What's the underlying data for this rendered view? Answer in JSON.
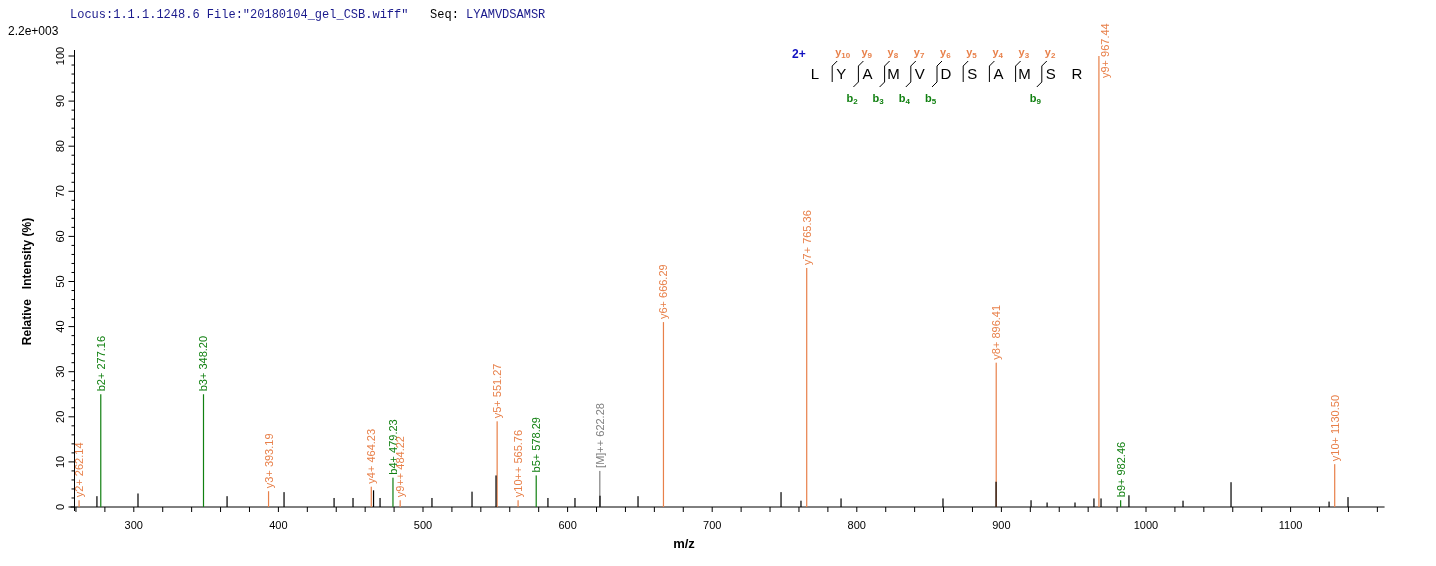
{
  "header": {
    "locus": "Locus:1.1.1.1248.6",
    "file": "File:\"20180104_gel_CSB.wiff\"",
    "seq_label": "Seq:",
    "seq": "LYAMVDSAMSR"
  },
  "scale_label": "2.2e+003",
  "fragment_map": {
    "charge": "2+",
    "residues": [
      "L",
      "Y",
      "A",
      "M",
      "V",
      "D",
      "S",
      "A",
      "M",
      "S",
      "R"
    ],
    "breaks": [
      {
        "y_ion": "y$_{10}$"
      },
      {
        "y_ion": "y$_{9}$",
        "b_ion": "b$_{2}$"
      },
      {
        "y_ion": "y$_{8}$",
        "b_ion": "b$_{3}$"
      },
      {
        "y_ion": "y$_{7}$",
        "b_ion": "b$_{4}$"
      },
      {
        "y_ion": "y$_{6}$",
        "b_ion": "b$_{5}$"
      },
      {
        "y_ion": "y$_{5}$"
      },
      {
        "y_ion": "y$_{4}$"
      },
      {
        "y_ion": "y$_{3}$"
      },
      {
        "y_ion": "y$_{2}$",
        "b_ion": "b$_{9}$"
      }
    ]
  },
  "chart_data": {
    "type": "bar",
    "xlabel": "m/z",
    "ylabel": "Relative   Intensity (%)",
    "xlim": [
      259,
      1165
    ],
    "ylim": [
      0,
      100
    ],
    "xticks": [
      300,
      400,
      500,
      600,
      700,
      800,
      900,
      1000,
      1100
    ],
    "yticks": [
      0,
      10,
      20,
      30,
      40,
      50,
      60,
      70,
      80,
      90,
      100
    ],
    "x": [
      262.14,
      274.5,
      277.16,
      302.9,
      348.2,
      364.5,
      393.19,
      403.9,
      438.5,
      451.6,
      464.23,
      465.8,
      470.3,
      479.23,
      484.22,
      506.2,
      533.9,
      550.5,
      551.27,
      565.76,
      578.29,
      586.4,
      605.1,
      622.28,
      622.4,
      648.7,
      666.29,
      747.6,
      761.4,
      765.36,
      789.1,
      859.6,
      896.3,
      896.41,
      920.5,
      931.6,
      950.9,
      964.0,
      967.44,
      968.9,
      982.46,
      988.2,
      1025.6,
      1058.8,
      1126.6,
      1130.5,
      1139.7
    ],
    "series": [
      {
        "color": "#e8804a",
        "values": [
          1.5,
          null,
          null,
          null,
          null,
          null,
          3.5,
          null,
          null,
          null,
          4.5,
          null,
          null,
          null,
          1.5,
          null,
          null,
          null,
          19,
          1.5,
          null,
          null,
          null,
          null,
          null,
          null,
          41,
          null,
          null,
          53,
          null,
          null,
          null,
          32,
          null,
          null,
          null,
          null,
          100,
          null,
          null,
          null,
          null,
          null,
          null,
          9.5,
          null
        ]
      },
      {
        "color": "#118011",
        "values": [
          null,
          null,
          25,
          null,
          25,
          null,
          null,
          null,
          null,
          null,
          null,
          null,
          null,
          6.5,
          null,
          null,
          null,
          null,
          null,
          null,
          7,
          null,
          null,
          null,
          null,
          null,
          null,
          null,
          null,
          null,
          null,
          null,
          null,
          null,
          null,
          null,
          null,
          null,
          null,
          null,
          1.5,
          null,
          null,
          null,
          null,
          null,
          null
        ]
      },
      {
        "color": "#808080",
        "values": [
          null,
          null,
          null,
          null,
          null,
          null,
          null,
          null,
          null,
          null,
          null,
          null,
          null,
          null,
          null,
          null,
          null,
          null,
          null,
          null,
          null,
          null,
          null,
          8,
          null,
          null,
          null,
          null,
          null,
          null,
          null,
          null,
          null,
          null,
          null,
          null,
          null,
          null,
          null,
          null,
          null,
          null,
          null,
          null,
          null,
          null,
          null
        ]
      },
      {
        "color": "#000000",
        "values": [
          null,
          2.4,
          null,
          3,
          null,
          2.4,
          null,
          3.3,
          2,
          2,
          null,
          3.7,
          2,
          null,
          null,
          2,
          3.4,
          7,
          null,
          null,
          null,
          2,
          2,
          null,
          2.5,
          2.4,
          null,
          3.3,
          1.4,
          null,
          1.9,
          1.9,
          5.6,
          null,
          1.5,
          1,
          1,
          1.9,
          null,
          1.9,
          null,
          2.6,
          1.4,
          5.5,
          1.2,
          null,
          2.2
        ]
      }
    ],
    "annotations": [
      {
        "x": 262.14,
        "y": 1.5,
        "text": "y2+ 262.14"
      },
      {
        "x": 277.16,
        "y": 25,
        "text": "b2+ 277.16"
      },
      {
        "x": 348.2,
        "y": 25,
        "text": "b3+ 348.20"
      },
      {
        "x": 393.19,
        "y": 3.5,
        "text": "y3+ 393.19"
      },
      {
        "x": 464.23,
        "y": 4.5,
        "text": "y4+ 464.23"
      },
      {
        "x": 479.23,
        "y": 6.5,
        "text": "b4+ 479.23"
      },
      {
        "x": 484.22,
        "y": 1.5,
        "text": "y9++ 484.22"
      },
      {
        "x": 551.27,
        "y": 19,
        "text": "y5+ 551.27"
      },
      {
        "x": 565.76,
        "y": 1.5,
        "text": "y10++ 565.76"
      },
      {
        "x": 578.29,
        "y": 7,
        "text": "b5+ 578.29"
      },
      {
        "x": 622.28,
        "y": 8,
        "text": "[M]++ 622.28"
      },
      {
        "x": 666.29,
        "y": 41,
        "text": "y6+ 666.29"
      },
      {
        "x": 765.36,
        "y": 53,
        "text": "y7+ 765.36"
      },
      {
        "x": 896.41,
        "y": 32,
        "text": "y8+ 896.41"
      },
      {
        "x": 967.44,
        "y": 100,
        "text": "y9+ 967.44"
      },
      {
        "x": 982.46,
        "y": 1.5,
        "text": "b9+ 982.46"
      },
      {
        "x": 1130.5,
        "y": 9.5,
        "text": "y10+ 1130.50"
      }
    ]
  }
}
